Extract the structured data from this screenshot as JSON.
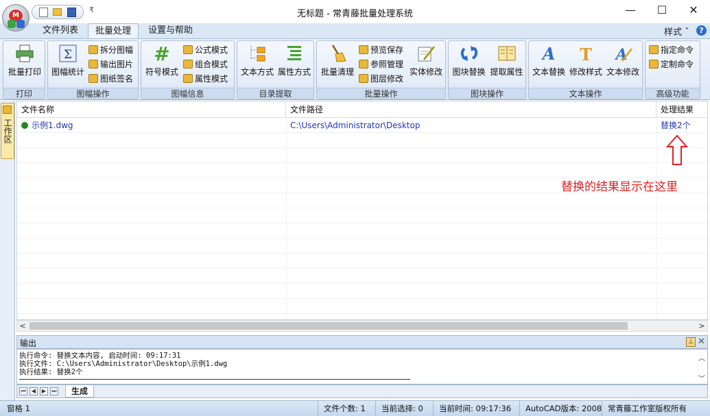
{
  "window": {
    "title": "无标题 - 常青藤批量处理系统",
    "minimize": "—",
    "maximize": "☐",
    "close": "✕"
  },
  "qat": {
    "more": "₹"
  },
  "tabs": [
    {
      "label": "文件列表"
    },
    {
      "label": "批量处理"
    },
    {
      "label": "设置与帮助"
    }
  ],
  "style_menu": "样式 ˇ",
  "ribbon": {
    "print": {
      "label": "打印",
      "buttons": [
        "批量打印"
      ]
    },
    "sheet_ops": {
      "label": "图幅操作",
      "big": "图幅统计",
      "small": [
        "拆分图幅",
        "输出图片",
        "图纸签名"
      ]
    },
    "sheet_info": {
      "label": "图幅信息",
      "big": "符号模式",
      "small": [
        "公式模式",
        "组合模式",
        "属性模式"
      ]
    },
    "dir_extract": {
      "label": "目录提取",
      "buttons": [
        "文本方式",
        "属性方式"
      ]
    },
    "batch_ops": {
      "label": "批量操作",
      "big": "批量清理",
      "small": [
        "预览保存",
        "参照管理",
        "图层修改"
      ],
      "big2": "实体修改"
    },
    "block_ops": {
      "label": "图块操作",
      "buttons": [
        "图块替换",
        "提取属性"
      ]
    },
    "text_ops": {
      "label": "文本操作",
      "buttons": [
        "文本替换",
        "修改样式",
        "文本修改"
      ]
    },
    "advanced": {
      "label": "高级功能",
      "small": [
        "指定命令",
        "定制命令"
      ]
    }
  },
  "sidebar": {
    "work_tab": "工作区"
  },
  "table": {
    "columns": [
      "文件名称",
      "文件路径",
      "处理结果"
    ],
    "rows": [
      {
        "name": "示例1.dwg",
        "path": "C:\\Users\\Administrator\\Desktop",
        "result": "替换2个"
      }
    ]
  },
  "annotation": "替换的结果显示在这里",
  "output": {
    "title": "输出",
    "lines": [
      "执行命令: 替换文本内容, 启动时间: 09:17:31",
      "执行文件: C:\\Users\\Administrator\\Desktop\\示例1.dwg",
      "执行结果: 替换2个"
    ],
    "tab": "生成"
  },
  "statusbar": {
    "window": "窗格 1",
    "file_count": "文件个数: 1",
    "selected": "当前选择: 0",
    "time": "当前时间: 09:17:36",
    "autocad": "AutoCAD版本: 2008",
    "copyright": "常青藤工作室版权所有"
  },
  "colors": {
    "link": "#2234b8",
    "annotation": "#e02020",
    "status_dot": "#1f8a1f"
  }
}
